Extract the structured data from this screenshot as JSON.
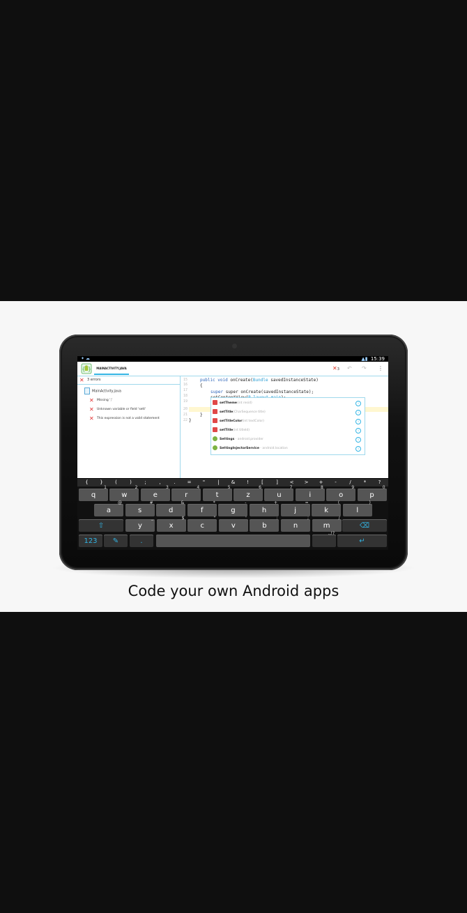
{
  "caption": "Code your own Android apps",
  "status": {
    "time": "15:39"
  },
  "editor_tab": "MAINACTIVITY.JAVA",
  "error_count_badge": "3",
  "errors": {
    "header": "3 errors",
    "file": "MainActivity.java",
    "items": [
      "Missing ';'",
      "Unknown variable or field 'sett'",
      "This expression is not a valid statement"
    ]
  },
  "code": {
    "line_numbers": [
      "15",
      "16",
      "17",
      "18",
      "19",
      "20",
      "21",
      "22"
    ],
    "line1_kw": "public void",
    "line1_fn": "onCreate(",
    "line1_type": "Bundle",
    "line1_rest": "savedInstanceState)",
    "line2": "{",
    "line3a": "super onCreate(savedInstanceState);",
    "line4a": "setContentView(",
    "line4b": "R.layout.main",
    "line4c": ");",
    "line5": "sett",
    "line6": "}",
    "line7": "}"
  },
  "autocomplete": [
    {
      "name": "setTheme",
      "sig": "(int resid)",
      "icon": "method-icon",
      "color": "#e04848"
    },
    {
      "name": "setTitle",
      "sig": "(CharSequence title)",
      "icon": "method-icon",
      "color": "#e04848"
    },
    {
      "name": "setTitleColor",
      "sig": "(int textColor)",
      "icon": "method-icon",
      "color": "#e04848"
    },
    {
      "name": "setTitle",
      "sig": "(int titleId)",
      "icon": "method-icon",
      "color": "#e04848"
    },
    {
      "name": "Settings",
      "sig": " - android.provider",
      "icon": "class-icon",
      "color": "#7cb342"
    },
    {
      "name": "SettingInjectorService",
      "sig": " - android.location",
      "icon": "class-icon",
      "color": "#7cb342"
    }
  ],
  "keyboard": {
    "symbols": [
      "{",
      "}",
      "(",
      ")",
      ";",
      ",",
      ".",
      "=",
      "\"",
      "|",
      "&",
      "!",
      "[",
      "]",
      "<",
      ">",
      "+",
      "-",
      "/",
      "*",
      "?"
    ],
    "row1": [
      [
        "q",
        "1"
      ],
      [
        "w",
        "2"
      ],
      [
        "e",
        "3"
      ],
      [
        "r",
        "4"
      ],
      [
        "t",
        "5"
      ],
      [
        "z",
        "6"
      ],
      [
        "u",
        "7"
      ],
      [
        "i",
        "8"
      ],
      [
        "o",
        "9"
      ],
      [
        "p",
        "0"
      ]
    ],
    "row2": [
      [
        "a",
        "@"
      ],
      [
        "s",
        "#"
      ],
      [
        "d",
        "&"
      ],
      [
        "f",
        "*"
      ],
      [
        "g",
        "-"
      ],
      [
        "h",
        "+"
      ],
      [
        "j",
        "="
      ],
      [
        "k",
        "("
      ],
      [
        "l",
        ")"
      ]
    ],
    "row3": [
      [
        "y",
        "_"
      ],
      [
        "x",
        "$"
      ],
      [
        "c",
        "\""
      ],
      [
        "v",
        "'"
      ],
      [
        "b",
        ":"
      ],
      [
        "n",
        ";"
      ],
      [
        "m",
        "/"
      ]
    ],
    "num_label": "123",
    "period_label": ".",
    "punct_label": ".,!?",
    "space_label": ""
  }
}
